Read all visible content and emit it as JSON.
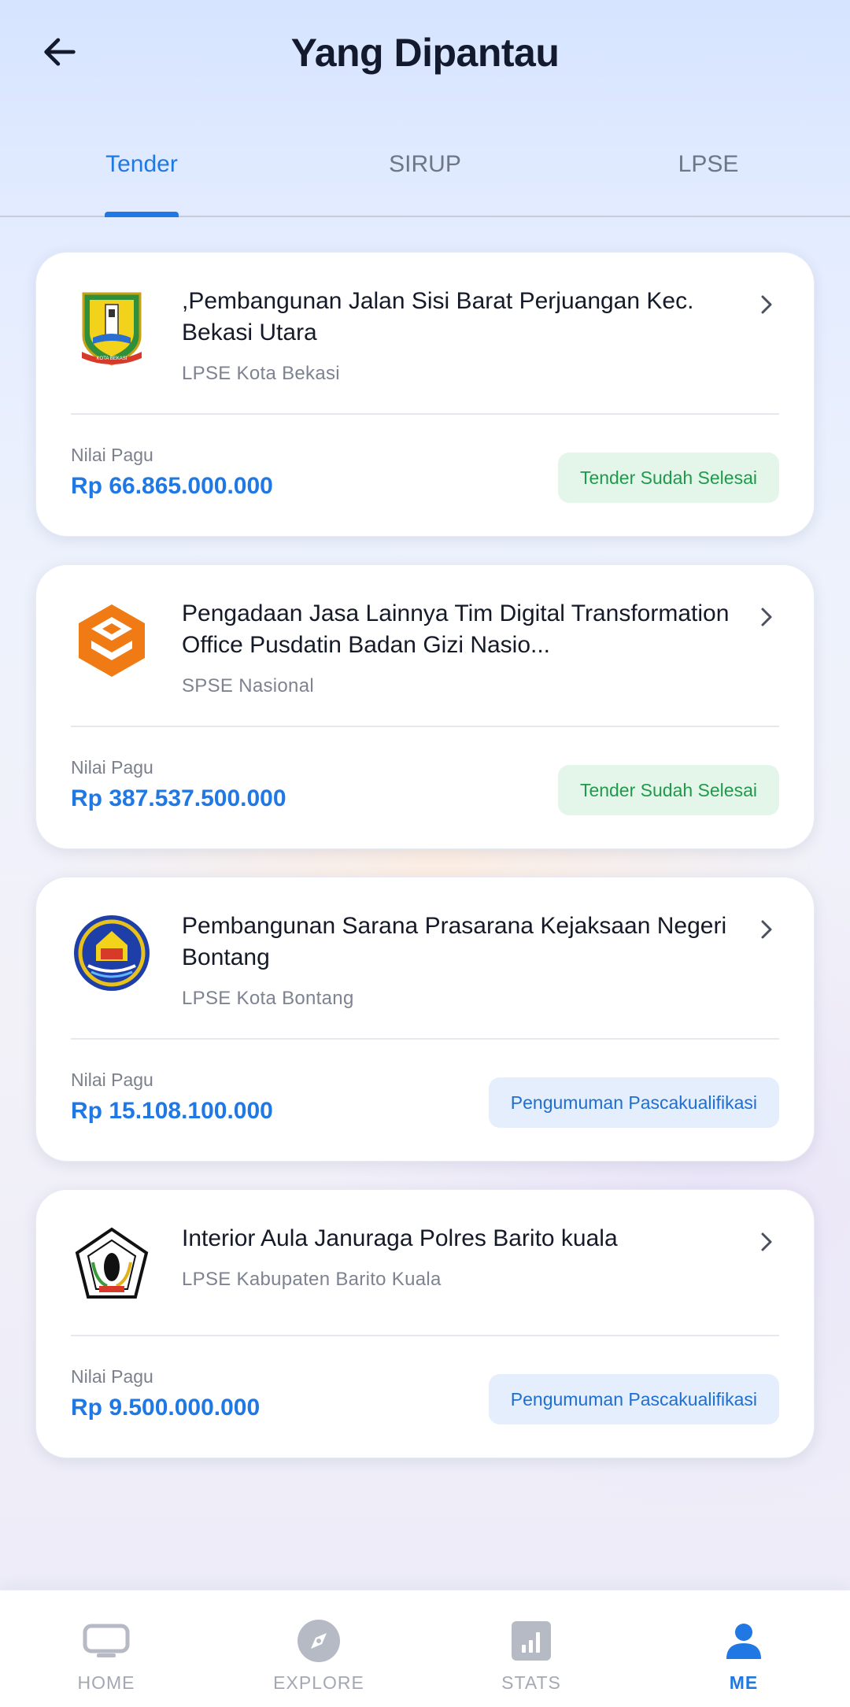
{
  "header": {
    "title": "Yang Dipantau"
  },
  "tabs": [
    {
      "label": "Tender"
    },
    {
      "label": "SIRUP"
    },
    {
      "label": "LPSE"
    }
  ],
  "cards": [
    {
      "title": ",Pembangunan Jalan Sisi Barat Perjuangan Kec. Bekasi Utara",
      "source": "LPSE Kota Bekasi",
      "pagu_label": "Nilai Pagu",
      "pagu_value": "Rp 66.865.000.000",
      "status": "Tender Sudah Selesai",
      "logo": "kota-bekasi-emblem",
      "logo_text": "KOTA BEKASI"
    },
    {
      "title": "Pengadaan Jasa Lainnya Tim Digital Transformation Office Pusdatin Badan Gizi Nasio...",
      "source": "SPSE Nasional",
      "pagu_label": "Nilai Pagu",
      "pagu_value": "Rp 387.537.500.000",
      "status": "Tender Sudah Selesai",
      "logo": "spse-logo"
    },
    {
      "title": "Pembangunan Sarana Prasarana Kejaksaan Negeri Bontang",
      "source": "LPSE Kota Bontang",
      "pagu_label": "Nilai Pagu",
      "pagu_value": "Rp 15.108.100.000",
      "status": "Pengumuman Pascakualifikasi",
      "logo": "kota-bontang-emblem"
    },
    {
      "title": "Interior Aula Januraga Polres Barito kuala",
      "source": "LPSE Kabupaten Barito Kuala",
      "pagu_label": "Nilai Pagu",
      "pagu_value": "Rp 9.500.000.000",
      "status": "Pengumuman Pascakualifikasi",
      "logo": "barito-kuala-emblem"
    }
  ],
  "nav": [
    {
      "label": "HOME",
      "icon": "tv-icon"
    },
    {
      "label": "EXPLORE",
      "icon": "compass-icon"
    },
    {
      "label": "STATS",
      "icon": "bar-chart-icon"
    },
    {
      "label": "ME",
      "icon": "person-icon"
    }
  ],
  "colors": {
    "accent": "#1f78e3",
    "status_done_bg": "#e4f6ea",
    "status_done_text": "#1f9a4a",
    "status_info_bg": "#e4eefc",
    "status_info_text": "#1f6fd1"
  }
}
